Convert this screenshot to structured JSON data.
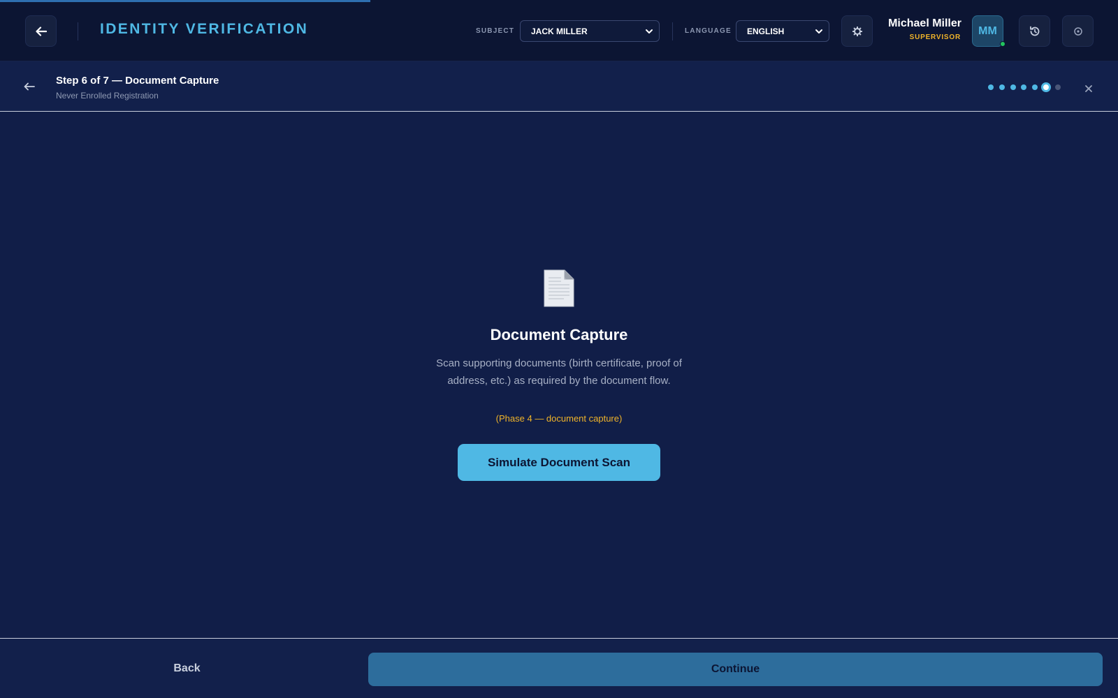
{
  "header": {
    "app_title": "IDENTITY VERIFICATION",
    "subject_label": "SUBJECT",
    "subject_value": "JACK MILLER",
    "language_label": "LANGUAGE",
    "language_value": "ENGLISH",
    "user_name": "Michael Miller",
    "user_role": "SUPERVISOR",
    "avatar_initials": "MM",
    "icons": {
      "back": "arrow-left-icon",
      "settings": "gear-icon",
      "history": "history-icon",
      "power": "power-icon"
    },
    "accent_color": "#4fb8e4",
    "role_color": "#f0b429",
    "online_color": "#22c55e"
  },
  "step": {
    "title": "Step 6 of 7 — Document Capture",
    "subtitle": "Never Enrolled Registration",
    "current": 6,
    "total": 7
  },
  "content": {
    "icon": "document-icon",
    "title": "Document Capture",
    "description": "Scan supporting documents (birth certificate, proof of address, etc.) as required by the document flow.",
    "note": "(Phase 4 — document capture)",
    "scan_button": "Simulate Document Scan"
  },
  "footer": {
    "back_label": "Back",
    "continue_label": "Continue"
  }
}
